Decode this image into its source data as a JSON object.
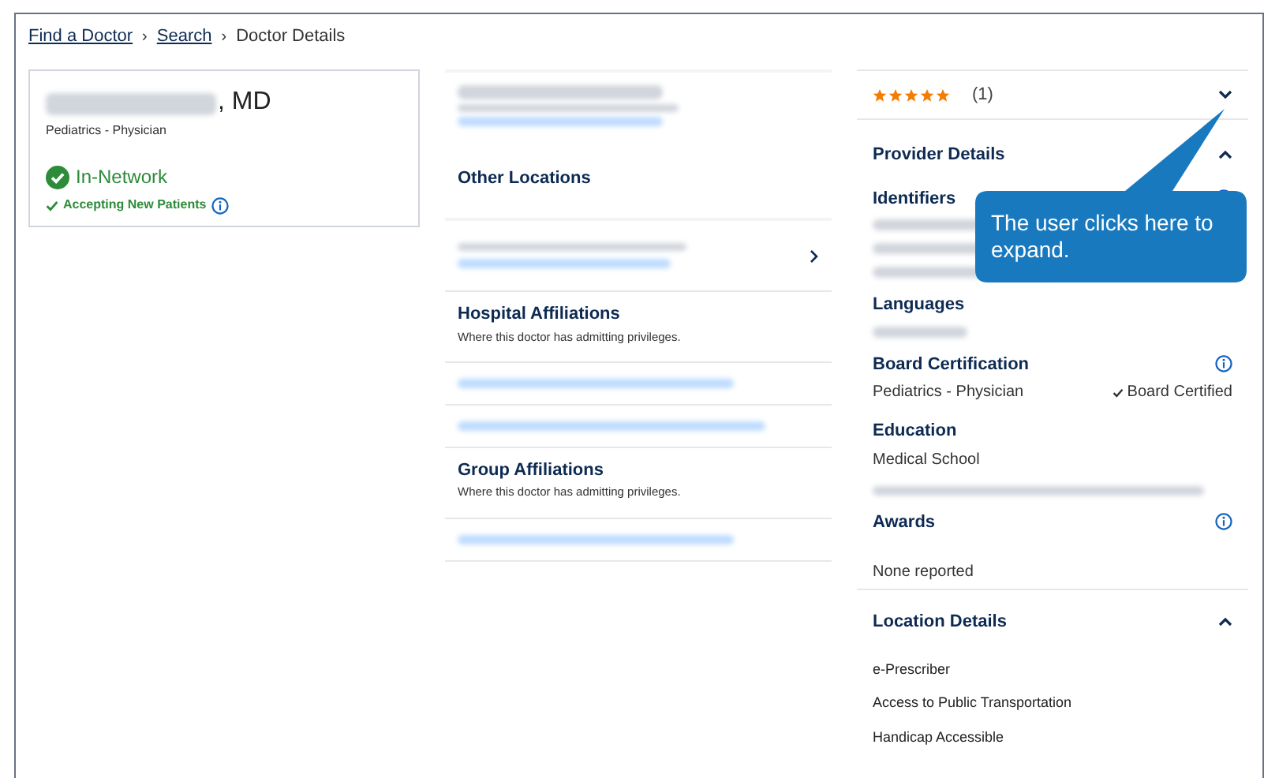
{
  "breadcrumb": [
    {
      "label": "Find a Doctor",
      "kind": "link",
      "separator": "›"
    },
    {
      "label": "Search",
      "kind": "link",
      "separator": "›"
    },
    {
      "label": "Doctor Details",
      "kind": "current"
    }
  ],
  "doctor": {
    "name_suffix": ", MD",
    "specialty": "Pediatrics - Physician",
    "network_status": "In-Network",
    "accepting": "Accepting New Patients"
  },
  "other_locations": {
    "title": "Other Locations"
  },
  "affiliations": [
    {
      "title": "Hospital Affiliations",
      "subtitle": "Where this doctor has admitting privileges."
    },
    {
      "title": "Group Affiliations",
      "subtitle": "Where this doctor has admitting privileges."
    }
  ],
  "rating": {
    "stars": 5,
    "count": "(1)",
    "expanded": false
  },
  "provider_details": {
    "title": "Provider Details",
    "expanded": true,
    "sections": [
      {
        "title": "Identifiers",
        "info": true,
        "kind": "redacted"
      },
      {
        "title": "Languages",
        "info": false,
        "kind": "redacted"
      },
      {
        "title": "Board Certification",
        "info": true,
        "kind": "certification",
        "value": "Pediatrics - Physician",
        "badge": "Board Certified"
      },
      {
        "title": "Education",
        "info": false,
        "kind": "education",
        "value": "Medical School"
      },
      {
        "title": "Awards",
        "info": true,
        "kind": "text",
        "value": "None reported"
      }
    ]
  },
  "location_details": {
    "title": "Location Details",
    "expanded": true,
    "items": [
      "e-Prescriber",
      "Access to Public Transportation",
      "Handicap Accessible"
    ]
  },
  "callout": {
    "text": "The user clicks here to expand."
  }
}
